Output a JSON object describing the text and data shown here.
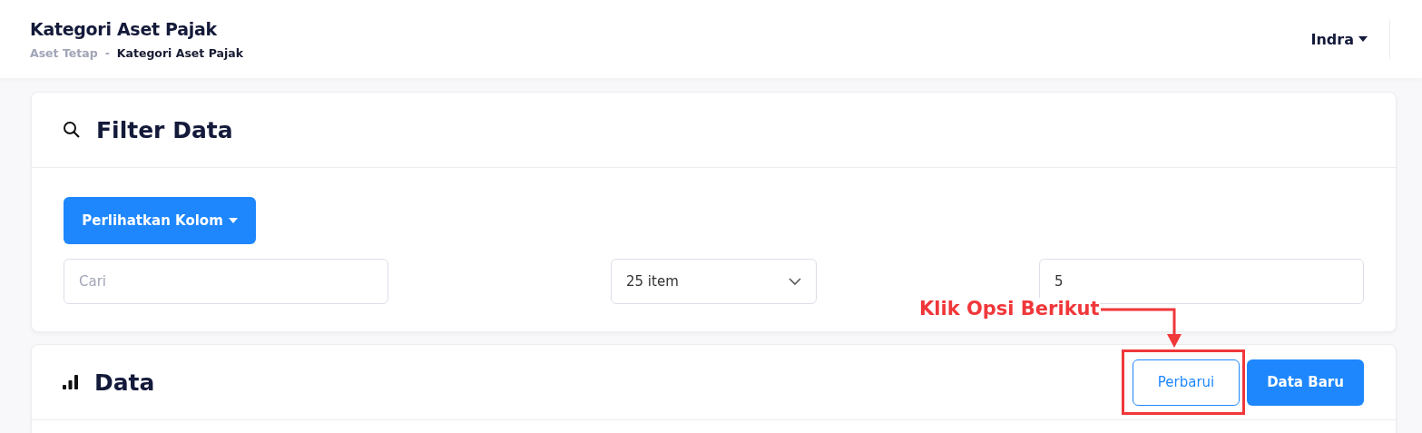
{
  "header": {
    "title": "Kategori Aset Pajak",
    "breadcrumb_separator": "-",
    "breadcrumb": [
      {
        "label": "Aset Tetap",
        "selected": false
      },
      {
        "label": "Kategori Aset Pajak",
        "selected": true
      }
    ],
    "user": "Indra"
  },
  "filter_card": {
    "title": "Filter Data",
    "columns_button": "Perlihatkan Kolom",
    "search": {
      "placeholder": "Cari"
    },
    "page_size": "25 item",
    "page_field": {
      "value": "5"
    }
  },
  "data_card": {
    "title": "Data",
    "buttons": [
      {
        "label": "Perbarui",
        "kind": "outline"
      },
      {
        "label": "Data Baru",
        "kind": "primary"
      }
    ]
  },
  "annotation": {
    "text": "Klik Opsi Berikut"
  }
}
